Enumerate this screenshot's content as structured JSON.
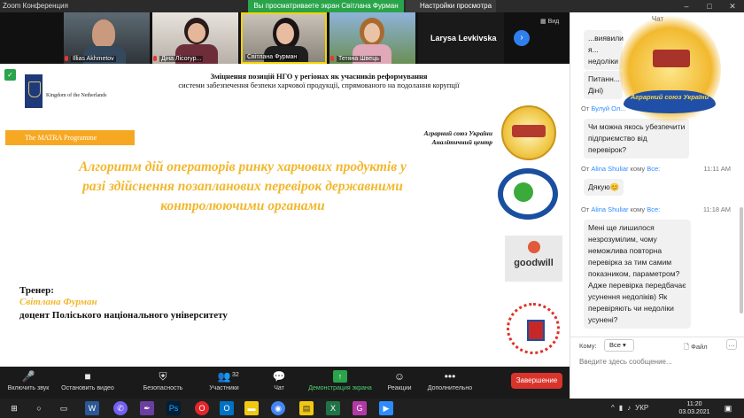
{
  "window": {
    "title": "Zoom Конференция",
    "share_banner": "Вы просматриваете экран Світлана Фурман",
    "view_options": "Настройки просмотра",
    "controls": [
      "–",
      "□",
      "✕"
    ]
  },
  "gallery": {
    "participants": [
      {
        "name": "Illias Akhmetov"
      },
      {
        "name": "Діна Лісогур..."
      },
      {
        "name": "Світлана Фурман"
      },
      {
        "name": "Тетяна Швець"
      }
    ],
    "overflow_name": "Larysa Levkivska",
    "view_label": "Вид"
  },
  "slide": {
    "header_line1": "Зміцнення позицій НГО у регіонах як учасників реформування",
    "header_line2": "системи забезпечення безпеки харчової продукції, спрямованого на подолання корупції",
    "netherlands": "Kingdom of the Netherlands",
    "matra": "The MATRA Programme",
    "union_line1": "Аграрний союз України",
    "union_line2": "Аналітичний центр",
    "title_lines": [
      "Алгоритм дій операторів ринку харчових продуктів у",
      "разі здійснення позапланових перевірок державними",
      "контролюючими органами"
    ],
    "trainer_label": "Тренер:",
    "trainer_name": "Світлана  Фурман",
    "trainer_position": "доцент Поліського національного університету",
    "goodwill": "goodwill",
    "accent_color": "#f3b72d"
  },
  "toolbar": {
    "mute": "Включить звук",
    "video": "Остановить видео",
    "security": "Безопасность",
    "participants": "Участники",
    "participants_count": "32",
    "chat": "Чат",
    "share_screen": "Демонстрация экрана",
    "reactions": "Реакции",
    "more": "Дополнительно",
    "end": "Завершение"
  },
  "chat": {
    "header": "Чат",
    "logo_text": "Аграрний союз України",
    "messages": [
      {
        "text_lines": [
          "...виявили я...",
          "недоліки"
        ]
      },
      {
        "text_lines": [
          "Питанн...",
          "Діні)"
        ]
      },
      {
        "sender": "Булуй Ол...",
        "text_lines": [
          "Чи можна якось убезпечити",
          "підприємство від",
          "перевірок?"
        ]
      },
      {
        "sender": "Alina Shuliar",
        "to_word": "кому",
        "recipient": "Все:",
        "from_word": "От",
        "time": "11:11 AM",
        "text_lines": [
          "Дякую😊"
        ]
      },
      {
        "sender": "Alina Shuliar",
        "to_word": "кому",
        "recipient": "Все:",
        "from_word": "От",
        "time": "11:18 AM",
        "text_lines": [
          "Мені ще лишилося",
          "незрозумілим, чому",
          "неможлива повторна",
          "перевірка за тим самим",
          "показником, параметром?",
          "Адже перевірка передбачає",
          "усунення недоліків) Як",
          "перевіряють чи недоліки",
          "усунені?"
        ]
      }
    ],
    "to_label": "Кому:",
    "to_value": "Все",
    "file_label": "Файл",
    "input_placeholder": "Введите здесь сообщение..."
  },
  "taskbar": {
    "lang": "УКР",
    "time": "11:20",
    "date": "03.03.2021"
  }
}
